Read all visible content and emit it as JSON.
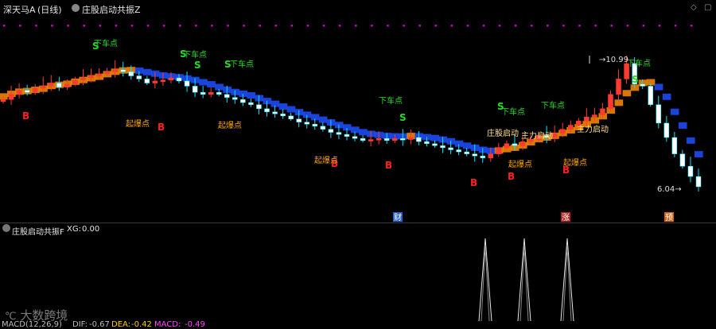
{
  "header": {
    "symbol": "深天马A",
    "period": "(日线)",
    "indicator": "庄股启动共振Z"
  },
  "subpanel": {
    "indicator": "庄股启动共振F",
    "xg_label": "XG:",
    "xg_value": "0.00"
  },
  "macd": {
    "label": "MACD(12,26,9)",
    "dif_label": "DIF:",
    "dif": "-0.67",
    "dea_label": "DEA:",
    "dea": "-0.42",
    "macd_label": "MACD:",
    "macd_val": "-0.49"
  },
  "watermark": "大数跨境",
  "colors": {
    "up": "#ff3b30",
    "down": "#00e5ff",
    "ribbon_up": "#ff8c00",
    "ribbon_down": "#1f4fff",
    "signal_b": "#ff2020",
    "signal_s": "#22dd22",
    "label": "#ffa500",
    "dots": "#cc00cc"
  },
  "chart_data": {
    "type": "candlestick",
    "count": 88,
    "closes": [
      15,
      20,
      24,
      22,
      26,
      28,
      31,
      27,
      30,
      34,
      36,
      38,
      40,
      42,
      44,
      42,
      38,
      35,
      31,
      33,
      34,
      36,
      33,
      28,
      22,
      20,
      22,
      20,
      17,
      15,
      12,
      10,
      6,
      3,
      1,
      -1,
      -4,
      -7,
      -9,
      -11,
      -14,
      -17,
      -19,
      -21,
      -23,
      -25,
      -24,
      -23,
      -25,
      -23,
      -24,
      -22,
      -26,
      -28,
      -30,
      -32,
      -34,
      -36,
      -38,
      -40,
      -42,
      -38,
      -32,
      -28,
      -30,
      -26,
      -24,
      -20,
      -22,
      -18,
      -14,
      -10,
      -6,
      -2,
      0,
      6,
      20,
      35,
      50,
      30,
      28,
      10,
      -8,
      -22,
      -38,
      -50,
      -60,
      -70
    ],
    "buy_signals_B": 7,
    "sell_signals_S": 7,
    "labels": {
      "sell": "下车点",
      "boom": "起爆点",
      "launch": "主力启动",
      "launch2": "庄股启动",
      "b": "B",
      "s": "S"
    },
    "peak_value": "10.99",
    "trough_value": "6.04",
    "event_markers": [
      "财",
      "涨",
      "预"
    ],
    "sub_spikes": 3
  }
}
